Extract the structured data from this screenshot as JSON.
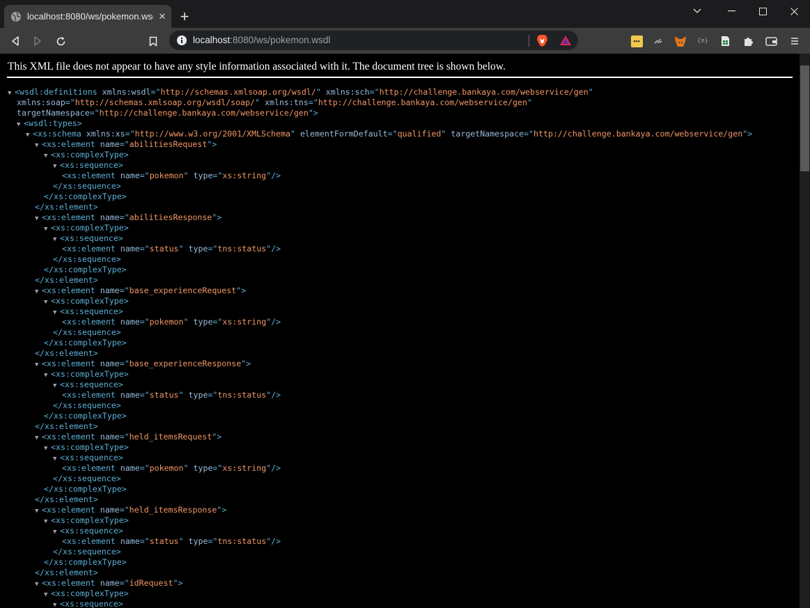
{
  "browser": {
    "tab_title": "localhost:8080/ws/pokemon.wsdl",
    "tab_close": "✕",
    "new_tab": "+",
    "url_host": "localhost",
    "url_rest": ":8080/ws/pokemon.wsdl",
    "window_controls": [
      "minimize-icon",
      "maximize-icon",
      "close-icon"
    ],
    "extensions": [
      "lastpass-icon",
      "extension-icon",
      "metamask-icon",
      "json-icon",
      "sheets-icon",
      "puzzle-icon",
      "wallet-icon",
      "menu-icon"
    ]
  },
  "notice": "This XML file does not appear to have any style information associated with it. The document tree is shown below.",
  "xml_lines": [
    {
      "indent": 0,
      "t": true,
      "parts": [
        [
          "tag",
          "<wsdl:definitions"
        ],
        [
          "sp",
          " "
        ],
        [
          "an",
          "xmlns:wsdl"
        ],
        [
          "tag",
          "=\""
        ],
        [
          "av",
          "http://schemas.xmlsoap.org/wsdl/"
        ],
        [
          "tag",
          "\""
        ],
        [
          "sp",
          " "
        ],
        [
          "an",
          "xmlns:sch"
        ],
        [
          "tag",
          "=\""
        ],
        [
          "av",
          "http://challenge.bankaya.com/webservice/gen"
        ],
        [
          "tag",
          "\""
        ]
      ]
    },
    {
      "indent": 1,
      "t": false,
      "parts": [
        [
          "an",
          "xmlns:soap"
        ],
        [
          "tag",
          "=\""
        ],
        [
          "av",
          "http://schemas.xmlsoap.org/wsdl/soap/"
        ],
        [
          "tag",
          "\""
        ],
        [
          "sp",
          " "
        ],
        [
          "an",
          "xmlns:tns"
        ],
        [
          "tag",
          "=\""
        ],
        [
          "av",
          "http://challenge.bankaya.com/webservice/gen"
        ],
        [
          "tag",
          "\""
        ]
      ]
    },
    {
      "indent": 1,
      "t": false,
      "parts": [
        [
          "an",
          "targetNamespace"
        ],
        [
          "tag",
          "=\""
        ],
        [
          "av",
          "http://challenge.bankaya.com/webservice/gen"
        ],
        [
          "tag",
          "\">"
        ]
      ]
    },
    {
      "indent": 1,
      "t": true,
      "parts": [
        [
          "tag",
          "<wsdl:types>"
        ]
      ]
    },
    {
      "indent": 2,
      "t": true,
      "parts": [
        [
          "tag",
          "<xs:schema"
        ],
        [
          "sp",
          " "
        ],
        [
          "an",
          "xmlns:xs"
        ],
        [
          "tag",
          "=\""
        ],
        [
          "av",
          "http://www.w3.org/2001/XMLSchema"
        ],
        [
          "tag",
          "\""
        ],
        [
          "sp",
          " "
        ],
        [
          "an",
          "elementFormDefault"
        ],
        [
          "tag",
          "=\""
        ],
        [
          "av",
          "qualified"
        ],
        [
          "tag",
          "\""
        ],
        [
          "sp",
          " "
        ],
        [
          "an",
          "targetNamespace"
        ],
        [
          "tag",
          "=\""
        ],
        [
          "av",
          "http://challenge.bankaya.com/webservice/gen"
        ],
        [
          "tag",
          "\">"
        ]
      ]
    },
    {
      "indent": 3,
      "t": true,
      "parts": [
        [
          "tag",
          "<xs:element"
        ],
        [
          "sp",
          " "
        ],
        [
          "an",
          "name"
        ],
        [
          "tag",
          "=\""
        ],
        [
          "av",
          "abilitiesRequest"
        ],
        [
          "tag",
          "\">"
        ]
      ]
    },
    {
      "indent": 4,
      "t": true,
      "parts": [
        [
          "tag",
          "<xs:complexType>"
        ]
      ]
    },
    {
      "indent": 5,
      "t": true,
      "parts": [
        [
          "tag",
          "<xs:sequence>"
        ]
      ]
    },
    {
      "indent": 6,
      "t": false,
      "parts": [
        [
          "tag",
          "<xs:element"
        ],
        [
          "sp",
          " "
        ],
        [
          "an",
          "name"
        ],
        [
          "tag",
          "=\""
        ],
        [
          "av",
          "pokemon"
        ],
        [
          "tag",
          "\""
        ],
        [
          "sp",
          " "
        ],
        [
          "an",
          "type"
        ],
        [
          "tag",
          "=\""
        ],
        [
          "av",
          "xs:string"
        ],
        [
          "tag",
          "\"/>"
        ]
      ]
    },
    {
      "indent": 5,
      "t": false,
      "parts": [
        [
          "tag",
          "</xs:sequence>"
        ]
      ]
    },
    {
      "indent": 4,
      "t": false,
      "parts": [
        [
          "tag",
          "</xs:complexType>"
        ]
      ]
    },
    {
      "indent": 3,
      "t": false,
      "parts": [
        [
          "tag",
          "</xs:element>"
        ]
      ]
    },
    {
      "indent": 3,
      "t": true,
      "parts": [
        [
          "tag",
          "<xs:element"
        ],
        [
          "sp",
          " "
        ],
        [
          "an",
          "name"
        ],
        [
          "tag",
          "=\""
        ],
        [
          "av",
          "abilitiesResponse"
        ],
        [
          "tag",
          "\">"
        ]
      ]
    },
    {
      "indent": 4,
      "t": true,
      "parts": [
        [
          "tag",
          "<xs:complexType>"
        ]
      ]
    },
    {
      "indent": 5,
      "t": true,
      "parts": [
        [
          "tag",
          "<xs:sequence>"
        ]
      ]
    },
    {
      "indent": 6,
      "t": false,
      "parts": [
        [
          "tag",
          "<xs:element"
        ],
        [
          "sp",
          " "
        ],
        [
          "an",
          "name"
        ],
        [
          "tag",
          "=\""
        ],
        [
          "av",
          "status"
        ],
        [
          "tag",
          "\""
        ],
        [
          "sp",
          " "
        ],
        [
          "an",
          "type"
        ],
        [
          "tag",
          "=\""
        ],
        [
          "av",
          "tns:status"
        ],
        [
          "tag",
          "\"/>"
        ]
      ]
    },
    {
      "indent": 5,
      "t": false,
      "parts": [
        [
          "tag",
          "</xs:sequence>"
        ]
      ]
    },
    {
      "indent": 4,
      "t": false,
      "parts": [
        [
          "tag",
          "</xs:complexType>"
        ]
      ]
    },
    {
      "indent": 3,
      "t": false,
      "parts": [
        [
          "tag",
          "</xs:element>"
        ]
      ]
    },
    {
      "indent": 3,
      "t": true,
      "parts": [
        [
          "tag",
          "<xs:element"
        ],
        [
          "sp",
          " "
        ],
        [
          "an",
          "name"
        ],
        [
          "tag",
          "=\""
        ],
        [
          "av",
          "base_experienceRequest"
        ],
        [
          "tag",
          "\">"
        ]
      ]
    },
    {
      "indent": 4,
      "t": true,
      "parts": [
        [
          "tag",
          "<xs:complexType>"
        ]
      ]
    },
    {
      "indent": 5,
      "t": true,
      "parts": [
        [
          "tag",
          "<xs:sequence>"
        ]
      ]
    },
    {
      "indent": 6,
      "t": false,
      "parts": [
        [
          "tag",
          "<xs:element"
        ],
        [
          "sp",
          " "
        ],
        [
          "an",
          "name"
        ],
        [
          "tag",
          "=\""
        ],
        [
          "av",
          "pokemon"
        ],
        [
          "tag",
          "\""
        ],
        [
          "sp",
          " "
        ],
        [
          "an",
          "type"
        ],
        [
          "tag",
          "=\""
        ],
        [
          "av",
          "xs:string"
        ],
        [
          "tag",
          "\"/>"
        ]
      ]
    },
    {
      "indent": 5,
      "t": false,
      "parts": [
        [
          "tag",
          "</xs:sequence>"
        ]
      ]
    },
    {
      "indent": 4,
      "t": false,
      "parts": [
        [
          "tag",
          "</xs:complexType>"
        ]
      ]
    },
    {
      "indent": 3,
      "t": false,
      "parts": [
        [
          "tag",
          "</xs:element>"
        ]
      ]
    },
    {
      "indent": 3,
      "t": true,
      "parts": [
        [
          "tag",
          "<xs:element"
        ],
        [
          "sp",
          " "
        ],
        [
          "an",
          "name"
        ],
        [
          "tag",
          "=\""
        ],
        [
          "av",
          "base_experienceResponse"
        ],
        [
          "tag",
          "\">"
        ]
      ]
    },
    {
      "indent": 4,
      "t": true,
      "parts": [
        [
          "tag",
          "<xs:complexType>"
        ]
      ]
    },
    {
      "indent": 5,
      "t": true,
      "parts": [
        [
          "tag",
          "<xs:sequence>"
        ]
      ]
    },
    {
      "indent": 6,
      "t": false,
      "parts": [
        [
          "tag",
          "<xs:element"
        ],
        [
          "sp",
          " "
        ],
        [
          "an",
          "name"
        ],
        [
          "tag",
          "=\""
        ],
        [
          "av",
          "status"
        ],
        [
          "tag",
          "\""
        ],
        [
          "sp",
          " "
        ],
        [
          "an",
          "type"
        ],
        [
          "tag",
          "=\""
        ],
        [
          "av",
          "tns:status"
        ],
        [
          "tag",
          "\"/>"
        ]
      ]
    },
    {
      "indent": 5,
      "t": false,
      "parts": [
        [
          "tag",
          "</xs:sequence>"
        ]
      ]
    },
    {
      "indent": 4,
      "t": false,
      "parts": [
        [
          "tag",
          "</xs:complexType>"
        ]
      ]
    },
    {
      "indent": 3,
      "t": false,
      "parts": [
        [
          "tag",
          "</xs:element>"
        ]
      ]
    },
    {
      "indent": 3,
      "t": true,
      "parts": [
        [
          "tag",
          "<xs:element"
        ],
        [
          "sp",
          " "
        ],
        [
          "an",
          "name"
        ],
        [
          "tag",
          "=\""
        ],
        [
          "av",
          "held_itemsRequest"
        ],
        [
          "tag",
          "\">"
        ]
      ]
    },
    {
      "indent": 4,
      "t": true,
      "parts": [
        [
          "tag",
          "<xs:complexType>"
        ]
      ]
    },
    {
      "indent": 5,
      "t": true,
      "parts": [
        [
          "tag",
          "<xs:sequence>"
        ]
      ]
    },
    {
      "indent": 6,
      "t": false,
      "parts": [
        [
          "tag",
          "<xs:element"
        ],
        [
          "sp",
          " "
        ],
        [
          "an",
          "name"
        ],
        [
          "tag",
          "=\""
        ],
        [
          "av",
          "pokemon"
        ],
        [
          "tag",
          "\""
        ],
        [
          "sp",
          " "
        ],
        [
          "an",
          "type"
        ],
        [
          "tag",
          "=\""
        ],
        [
          "av",
          "xs:string"
        ],
        [
          "tag",
          "\"/>"
        ]
      ]
    },
    {
      "indent": 5,
      "t": false,
      "parts": [
        [
          "tag",
          "</xs:sequence>"
        ]
      ]
    },
    {
      "indent": 4,
      "t": false,
      "parts": [
        [
          "tag",
          "</xs:complexType>"
        ]
      ]
    },
    {
      "indent": 3,
      "t": false,
      "parts": [
        [
          "tag",
          "</xs:element>"
        ]
      ]
    },
    {
      "indent": 3,
      "t": true,
      "parts": [
        [
          "tag",
          "<xs:element"
        ],
        [
          "sp",
          " "
        ],
        [
          "an",
          "name"
        ],
        [
          "tag",
          "=\""
        ],
        [
          "av",
          "held_itemsResponse"
        ],
        [
          "tag",
          "\">"
        ]
      ]
    },
    {
      "indent": 4,
      "t": true,
      "parts": [
        [
          "tag",
          "<xs:complexType>"
        ]
      ]
    },
    {
      "indent": 5,
      "t": true,
      "parts": [
        [
          "tag",
          "<xs:sequence>"
        ]
      ]
    },
    {
      "indent": 6,
      "t": false,
      "parts": [
        [
          "tag",
          "<xs:element"
        ],
        [
          "sp",
          " "
        ],
        [
          "an",
          "name"
        ],
        [
          "tag",
          "=\""
        ],
        [
          "av",
          "status"
        ],
        [
          "tag",
          "\""
        ],
        [
          "sp",
          " "
        ],
        [
          "an",
          "type"
        ],
        [
          "tag",
          "=\""
        ],
        [
          "av",
          "tns:status"
        ],
        [
          "tag",
          "\"/>"
        ]
      ]
    },
    {
      "indent": 5,
      "t": false,
      "parts": [
        [
          "tag",
          "</xs:sequence>"
        ]
      ]
    },
    {
      "indent": 4,
      "t": false,
      "parts": [
        [
          "tag",
          "</xs:complexType>"
        ]
      ]
    },
    {
      "indent": 3,
      "t": false,
      "parts": [
        [
          "tag",
          "</xs:element>"
        ]
      ]
    },
    {
      "indent": 3,
      "t": true,
      "parts": [
        [
          "tag",
          "<xs:element"
        ],
        [
          "sp",
          " "
        ],
        [
          "an",
          "name"
        ],
        [
          "tag",
          "=\""
        ],
        [
          "av",
          "idRequest"
        ],
        [
          "tag",
          "\">"
        ]
      ]
    },
    {
      "indent": 4,
      "t": true,
      "parts": [
        [
          "tag",
          "<xs:complexType>"
        ]
      ]
    },
    {
      "indent": 5,
      "t": true,
      "parts": [
        [
          "tag",
          "<xs:sequence>"
        ]
      ]
    }
  ],
  "colors": {
    "tag": "#5db0d7",
    "attr_name": "#9bbbdc",
    "attr_value": "#f29766",
    "background": "#000000",
    "toolbar": "#3c3c3c"
  }
}
